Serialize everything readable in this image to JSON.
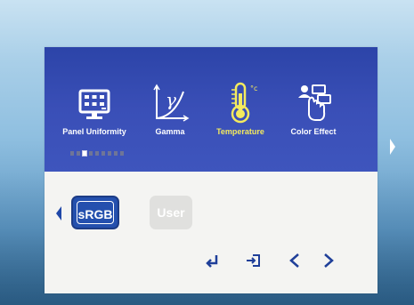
{
  "menu": {
    "items": [
      {
        "label": "Panel Uniformity",
        "icon": "panel-uniformity-icon",
        "selected": false
      },
      {
        "label": "Gamma",
        "icon": "gamma-curve-icon",
        "selected": false
      },
      {
        "label": "Temperature",
        "icon": "thermometer-icon",
        "selected": true
      },
      {
        "label": "Color Effect",
        "icon": "color-effect-icon",
        "selected": false
      }
    ],
    "page_indicator": {
      "total": 9,
      "active": 3
    }
  },
  "options": {
    "items": [
      {
        "label": "sRGB",
        "selected": true
      },
      {
        "label": "User",
        "selected": false
      }
    ]
  },
  "icons": {
    "gamma_symbol": "γ",
    "temperature_unit": "°c"
  },
  "colors": {
    "osd_top": "#3a4fb7",
    "osd_body": "#f4f4f2",
    "selected_label": "#f4ea5e",
    "selected_option": "#2450ae"
  }
}
